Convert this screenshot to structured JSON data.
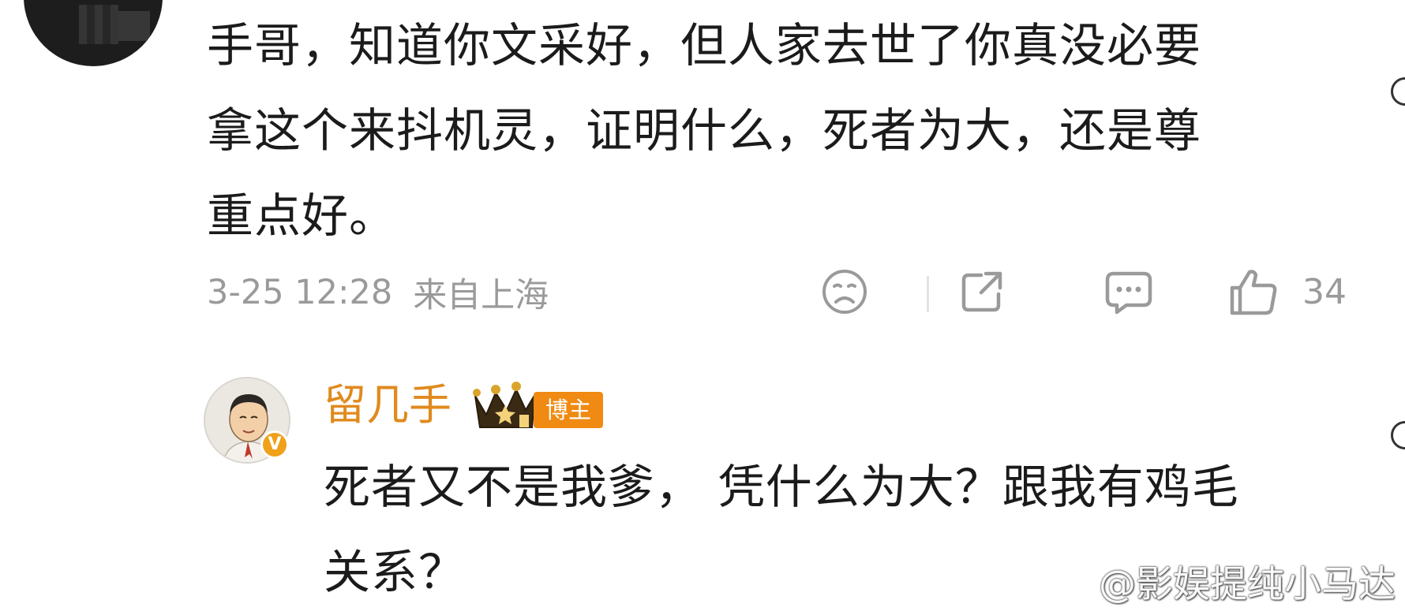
{
  "comment": {
    "text": "手哥，知道你文采好，但人家去世了你真没必要\n拿这个来抖机灵，证明什么，死者为大，还是尊\n重点好。",
    "date": "3-25 12:28",
    "location": "来自上海",
    "like_count": "34",
    "icons": [
      "dislike-face-icon",
      "share-icon",
      "comment-icon",
      "thumbs-up-icon"
    ]
  },
  "reply": {
    "username": "留几手",
    "tag": "博主",
    "verified_badge": "V",
    "text": "死者又不是我爹，  凭什么为大？跟我有鸡毛\n关系？"
  },
  "watermark": {
    "text": "@影娱提纯小马达"
  },
  "colors": {
    "username": "#e08a1e",
    "tag_bg": "#f08a12",
    "meta_gray": "#9a9a9a"
  }
}
